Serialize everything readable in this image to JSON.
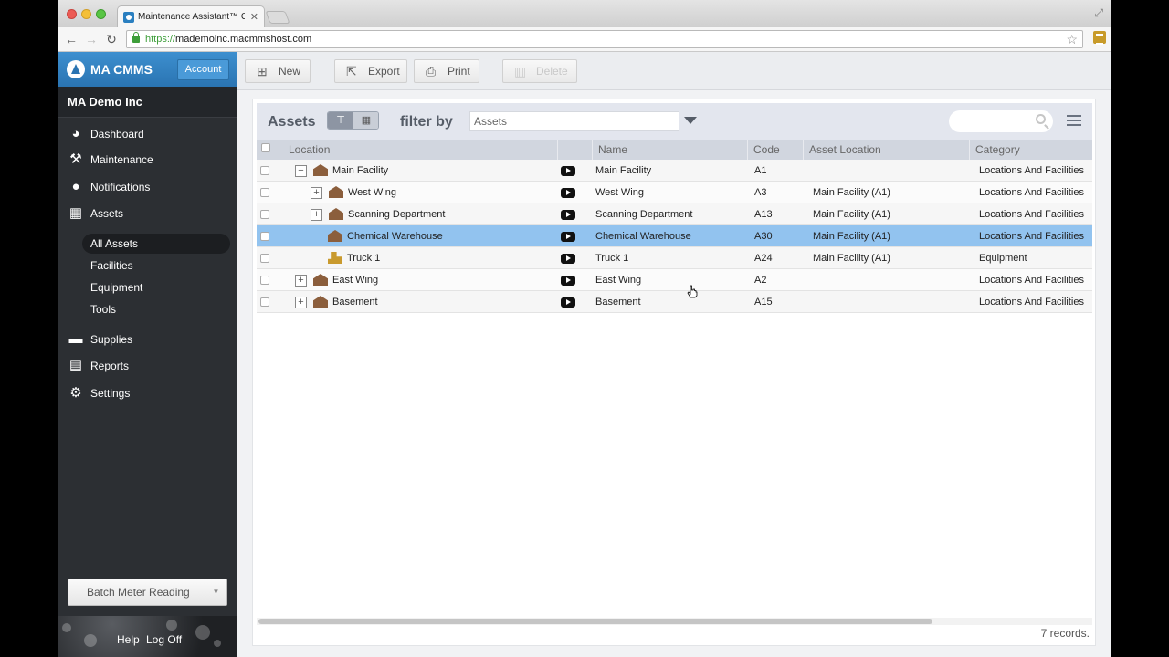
{
  "browser": {
    "tab_title": "Maintenance Assistant™ CMMS",
    "tab_close": "✕",
    "url_scheme": "https://",
    "url_host": "mademoinc.macmmshost.com"
  },
  "sidebar": {
    "brand": "MA CMMS",
    "account_label": "Account",
    "org_name": "MA Demo Inc",
    "nav": [
      {
        "label": "Dashboard",
        "icon": "dashboard-icon"
      },
      {
        "label": "Maintenance",
        "icon": "tools-icon"
      },
      {
        "label": "Notifications",
        "icon": "speech-bubble-icon"
      },
      {
        "label": "Assets",
        "icon": "cubes-icon"
      },
      {
        "label": "Supplies",
        "icon": "truck-icon"
      },
      {
        "label": "Reports",
        "icon": "chart-icon"
      },
      {
        "label": "Settings",
        "icon": "gear-icon"
      }
    ],
    "asset_subnav": [
      "All Assets",
      "Facilities",
      "Equipment",
      "Tools"
    ],
    "batch_label": "Batch Meter Reading",
    "help_label": "Help",
    "logoff_label": "Log Off"
  },
  "actions": {
    "new": "New",
    "export": "Export",
    "print": "Print",
    "delete": "Delete"
  },
  "panel": {
    "title": "Assets",
    "filter_label": "filter by",
    "filter_value": "Assets",
    "search_placeholder": ""
  },
  "grid": {
    "columns": [
      "Location",
      "Name",
      "Code",
      "Asset Location",
      "Category"
    ],
    "rows": [
      {
        "location": "Main Facility",
        "name": "Main Facility",
        "code": "A1",
        "asset_location": "",
        "category": "Locations And Facilities",
        "expander": "−"
      },
      {
        "location": "West Wing",
        "name": "West Wing",
        "code": "A3",
        "asset_location": "Main Facility (A1)",
        "category": "Locations And Facilities",
        "expander": "+"
      },
      {
        "location": "Scanning Department",
        "name": "Scanning Department",
        "code": "A13",
        "asset_location": "Main Facility (A1)",
        "category": "Locations And Facilities",
        "expander": "+"
      },
      {
        "location": "Chemical Warehouse",
        "name": "Chemical Warehouse",
        "code": "A30",
        "asset_location": "Main Facility (A1)",
        "category": "Locations And Facilities",
        "expander": ""
      },
      {
        "location": "Truck 1",
        "name": "Truck 1",
        "code": "A24",
        "asset_location": "Main Facility (A1)",
        "category": "Equipment",
        "expander": ""
      },
      {
        "location": "East Wing",
        "name": "East Wing",
        "code": "A2",
        "asset_location": "",
        "category": "Locations And Facilities",
        "expander": "+"
      },
      {
        "location": "Basement",
        "name": "Basement",
        "code": "A15",
        "asset_location": "",
        "category": "Locations And Facilities",
        "expander": "+"
      }
    ],
    "records_text": "7 records."
  },
  "colors": {
    "brand_blue": "#2a74b2",
    "selected_row": "#92c3ef",
    "sidebar_bg": "#2c2f33"
  }
}
